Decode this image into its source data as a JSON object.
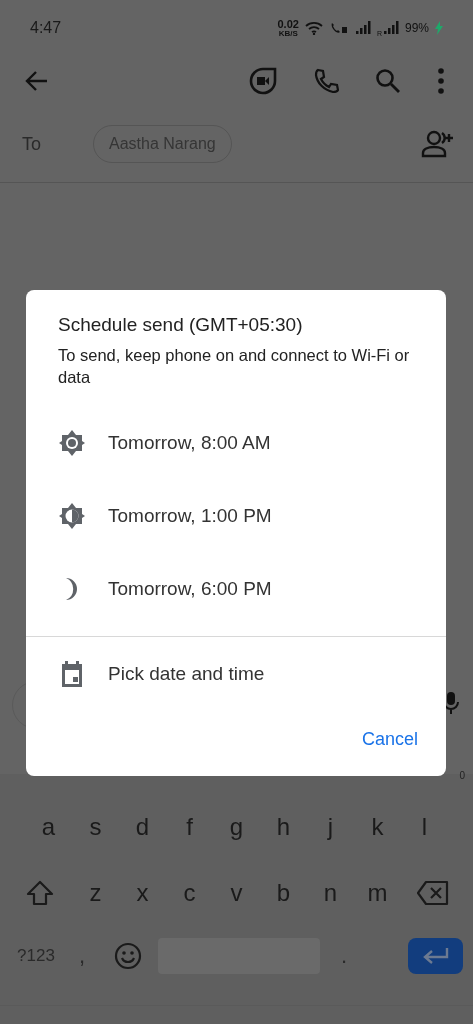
{
  "status_bar": {
    "time": "4:47",
    "net_speed": "0.02",
    "net_unit": "KB/S",
    "roaming": "R",
    "battery": "99%",
    "charging": true
  },
  "recipients": {
    "label": "To",
    "chips": [
      "Aastha Narang"
    ]
  },
  "dialog": {
    "title": "Schedule send (GMT+05:30)",
    "subtitle": "To send, keep phone on and connect to Wi-Fi or data",
    "options": [
      {
        "kind": "morning",
        "label": "Tomorrow, 8:00 AM"
      },
      {
        "kind": "afternoon",
        "label": "Tomorrow, 1:00 PM"
      },
      {
        "kind": "evening",
        "label": "Tomorrow, 6:00 PM"
      }
    ],
    "custom": {
      "kind": "calendar",
      "label": "Pick date and time"
    },
    "cancel": "Cancel"
  },
  "keyboard": {
    "key_hint": "0",
    "home_row_keys": [
      "a",
      "s",
      "d",
      "f",
      "g",
      "h",
      "j",
      "k",
      "l"
    ],
    "lower_row_keys": [
      "z",
      "x",
      "c",
      "v",
      "b",
      "n",
      "m"
    ],
    "symbols": "?123",
    "comma": ",",
    "period": "."
  }
}
